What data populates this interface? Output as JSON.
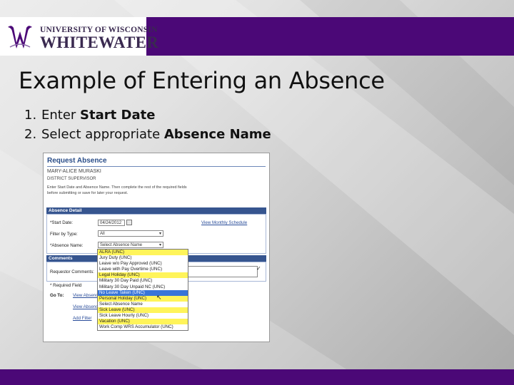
{
  "header": {
    "logo_line1": "UNIVERSITY OF WISCONSIN",
    "logo_line2": "WHITEWATER",
    "brand_color": "#4b0877"
  },
  "slide": {
    "title": "Example of Entering an Absence",
    "steps": [
      {
        "num": "1.",
        "text": "Enter ",
        "bold": "Start Date"
      },
      {
        "num": "2.",
        "text": "Select appropriate ",
        "bold": "Absence Name"
      }
    ]
  },
  "screenshot": {
    "title": "Request Absence",
    "employee": "MARY-ALICE MURASKI",
    "job": "DISTRICT SUPERVISOR",
    "instructions_1": "Enter Start Date and Absence Name. Then complete the rest of the required fields",
    "instructions_2": "before submitting or save for later your request.",
    "section_detail": "Absence Detail",
    "start_date_label": "*Start Date:",
    "start_date_value": "04/24/2012",
    "view_schedule_link": "View Monthly Schedule",
    "filter_label": "Filter by Type:",
    "filter_value": "All",
    "absence_name_label": "*Absence Name:",
    "absence_name_value": "Select Absence Name",
    "section_comments": "Comments",
    "requestor_comments_label": "Requestor Comments:",
    "required_note": "* Required Field",
    "goto_label": "Go To:",
    "goto_link1": "View Absence",
    "goto_link2": "View Absence",
    "goto_link3": "Add Filter",
    "dropdown_options": [
      {
        "label": "ALRA (UNC)",
        "style": "highlight"
      },
      {
        "label": "Jury Duty (UNC)",
        "style": "normal"
      },
      {
        "label": "Leave w/o Pay Approved (UNC)",
        "style": "normal"
      },
      {
        "label": "Leave with Pay Overtime (UNC)",
        "style": "normal"
      },
      {
        "label": "Legal Holiday (UNC)",
        "style": "highlight"
      },
      {
        "label": "Military 30 Day Paid (UNC)",
        "style": "normal"
      },
      {
        "label": "Military 30 Day Unpaid NC (UNC)",
        "style": "normal"
      },
      {
        "label": "No Leave Taken (UNC)",
        "style": "selected"
      },
      {
        "label": "Personal Holiday (UNC)",
        "style": "highlight"
      },
      {
        "label": "Select Absence Name",
        "style": "normal"
      },
      {
        "label": "Sick Leave (UNC)",
        "style": "highlight"
      },
      {
        "label": "Sick Leave Hourly (UNC)",
        "style": "normal"
      },
      {
        "label": "Vacation (UNC)",
        "style": "highlight"
      },
      {
        "label": "Work Comp WRS Accumulator (UNC)",
        "style": "normal"
      }
    ]
  }
}
